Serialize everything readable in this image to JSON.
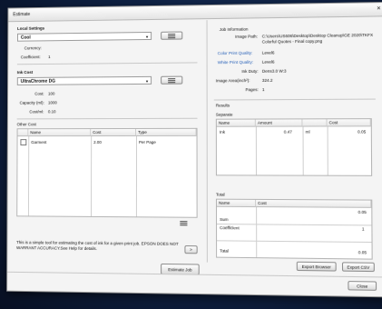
{
  "window": {
    "title": "Estimate"
  },
  "left": {
    "local_settings": {
      "title": "Local Settings",
      "selected": "Cool",
      "currency_label": "Currency:",
      "currency_value": "",
      "coefficient_label": "Coefficient:",
      "coefficient_value": "1"
    },
    "ink_cost": {
      "title": "Ink Cost",
      "selected": "UltraChrome DG",
      "cost_label": "Cost:",
      "cost_value": "100",
      "capacity_label": "Capacity (ml):",
      "capacity_value": "1000",
      "costml_label": "Cost/ml:",
      "costml_value": "0.10"
    },
    "other_cost": {
      "title": "Other Cost",
      "columns": [
        "Name",
        "Cost",
        "Type"
      ],
      "rows": [
        {
          "name": "Garment",
          "cost": "2.00",
          "type": "Per Page"
        }
      ]
    },
    "note": "This is a simple tool for estimating the cost of ink for a given print job. EPSON DOES NOT WARRANT ACCURACY.See Help for details.",
    "help_button": ">",
    "estimate_button": "Estimate Job"
  },
  "right": {
    "job_info": {
      "title": "Job Information",
      "image_path_label": "Image Path:",
      "image_path_value": "C:\\Users\\US606\\Desktop\\Desktop Cleanup\\GE 2020\\TKFX Colorful Quotes - Final copy.png",
      "color_quality_label": "Color Print Quality:",
      "color_quality_value": "Level6",
      "white_quality_label": "White Print Quality:",
      "white_quality_value": "Level6",
      "ink_duty_label": "Ink Duty:",
      "ink_duty_value": "Dens3.0 W:3",
      "image_area_label": "Image Area(inch²):",
      "image_area_value": "324.2",
      "pages_label": "Pages:",
      "pages_value": "1"
    },
    "results": {
      "title": "Results",
      "separate_label": "Separate",
      "separate_columns": [
        "Name",
        "Amount",
        "",
        "Cost"
      ],
      "separate_rows": [
        {
          "name": "Ink",
          "amount": "0.47",
          "unit": "ml",
          "cost": "0.05"
        }
      ],
      "total_label": "Total",
      "total_columns": [
        "Name",
        "Cost"
      ],
      "total_rows": [
        {
          "name": "",
          "cost": "0.05"
        },
        {
          "name": "Sum",
          "cost": ""
        },
        {
          "name": "Coefficient",
          "cost": "1"
        },
        {
          "name": "",
          "cost": ""
        },
        {
          "name": "Total",
          "cost": "0.05"
        }
      ],
      "export_browser_button": "Export Browser",
      "export_csv_button": "Export CSV"
    }
  },
  "close_button": "Close"
}
